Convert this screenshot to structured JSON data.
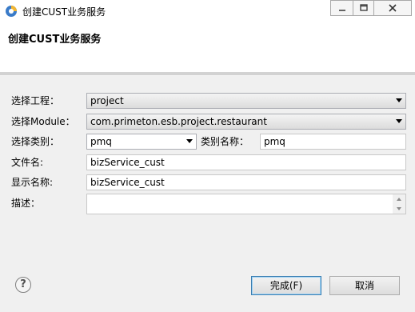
{
  "window": {
    "title": "创建CUST业务服务",
    "header_title": "创建CUST业务服务"
  },
  "form": {
    "project": {
      "label": "选择工程：",
      "value": "project"
    },
    "module": {
      "label": "选择Module：",
      "value": "com.primeton.esb.project.restaurant"
    },
    "category": {
      "label": "选择类别：",
      "value": "pmq"
    },
    "category_name": {
      "label": "类别名称：",
      "value": "pmq"
    },
    "file_name": {
      "label": "文件名:",
      "value": "bizService_cust"
    },
    "display_name": {
      "label": "显示名称:",
      "value": "bizService_cust"
    },
    "description": {
      "label": "描述：",
      "value": ""
    }
  },
  "buttons": {
    "help": "?",
    "finish": "完成(F)",
    "cancel": "取消"
  },
  "colors": {
    "accent_border": "#3c7fb1",
    "field_border": "#c8c8c8",
    "background": "#f0f0f0"
  }
}
